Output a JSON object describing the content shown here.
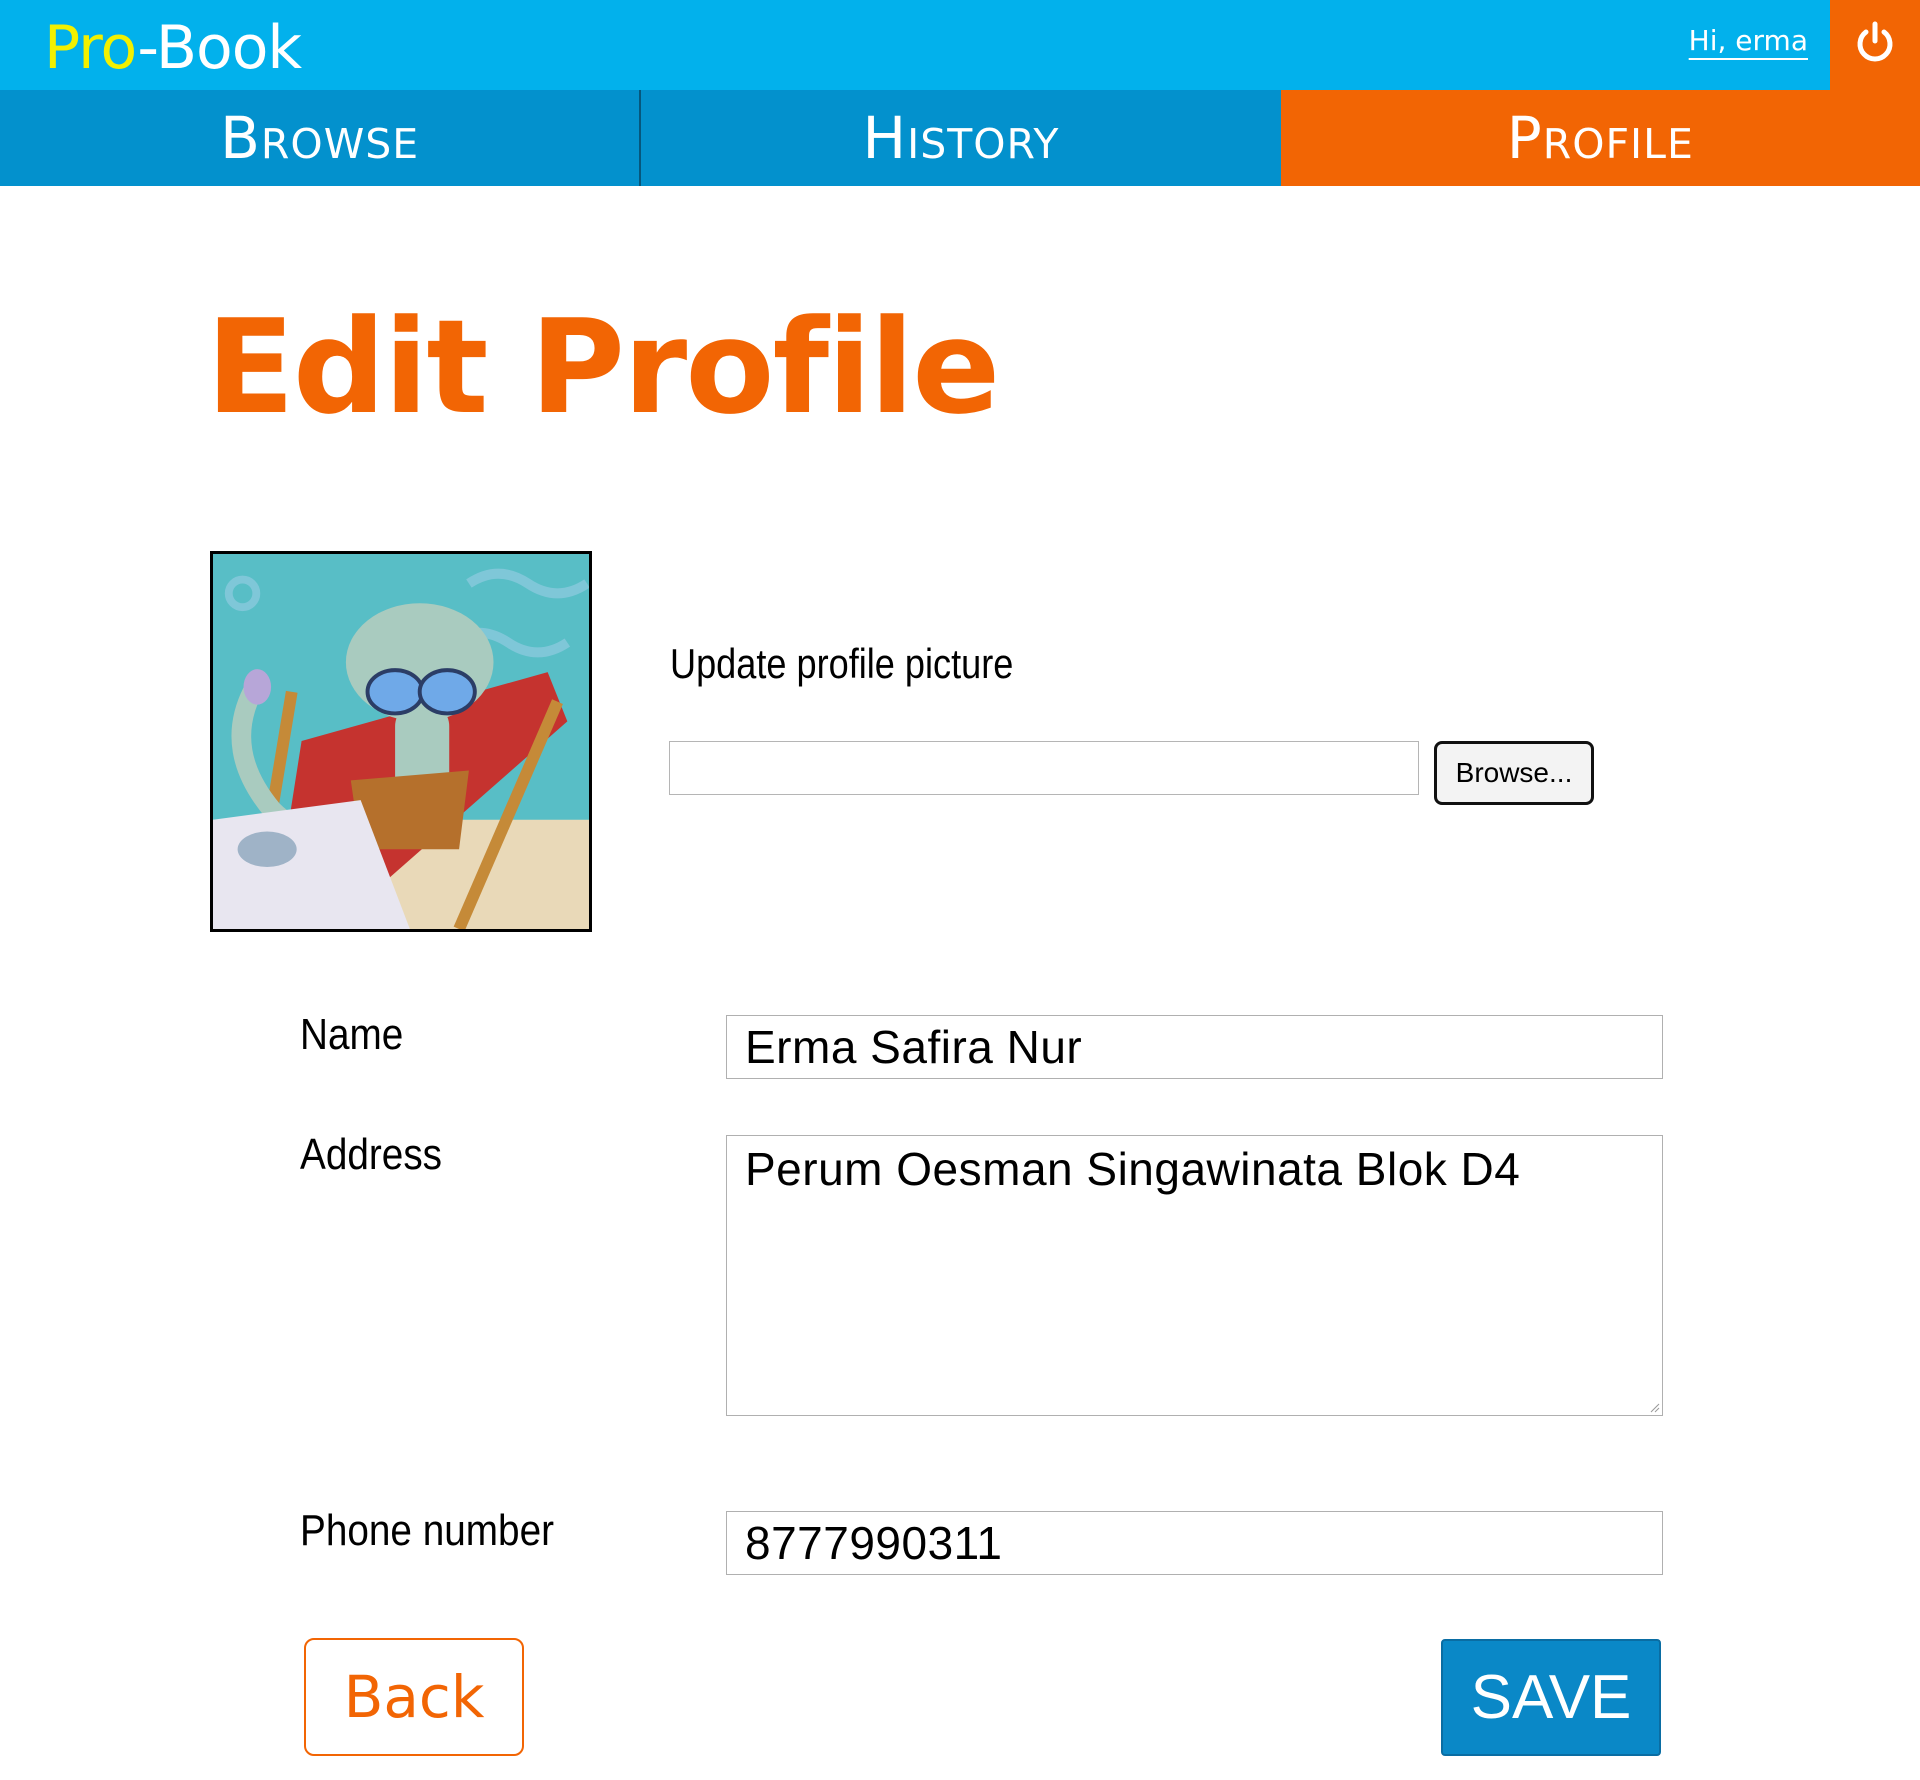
{
  "header": {
    "logo_part1": "Pro",
    "logo_part2": "-Book",
    "greeting": "Hi, erma",
    "logout_icon": "power-icon"
  },
  "tabs": [
    {
      "label": "Browse",
      "active": false
    },
    {
      "label": "History",
      "active": false
    },
    {
      "label": "Profile",
      "active": true
    }
  ],
  "page": {
    "title": "Edit Profile"
  },
  "avatar": {
    "icon": "profile-picture",
    "alt": "profile picture"
  },
  "upload": {
    "label": "Update profile picture",
    "file_value": "",
    "browse_label": "Browse..."
  },
  "form": {
    "name_label": "Name",
    "name_value": "Erma Safira Nur",
    "address_label": "Address",
    "address_value": "Perum Oesman Singawinata Blok D4",
    "phone_label": "Phone number",
    "phone_value": "8777990311"
  },
  "actions": {
    "back_label": "Back",
    "save_label": "SAVE"
  },
  "colors": {
    "topbar": "#02b1ec",
    "tab": "#0391cd",
    "accent": "#f26504",
    "logo_highlight": "#f2f000",
    "save": "#0a88c7"
  }
}
